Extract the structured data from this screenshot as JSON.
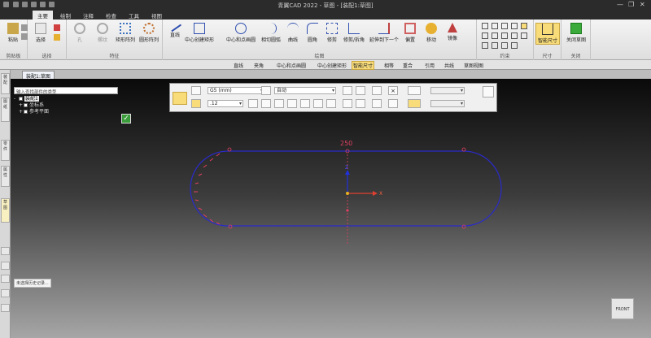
{
  "window": {
    "title": "青翼CAD 2022 - 草图 - [装配1:草图]",
    "controls": [
      "—",
      "❐",
      "✕"
    ]
  },
  "menu": {
    "tabs": [
      "主要",
      "绘制",
      "注释",
      "检查",
      "工具",
      "视图"
    ],
    "active": "主要"
  },
  "ribbon": {
    "clipboard": {
      "label": "剪贴板",
      "paste": "粘贴"
    },
    "select": {
      "label": "选择",
      "select": "选择"
    },
    "feature": {
      "label": "特征",
      "f1": "孔",
      "f2": "螺纹",
      "f3": "矩形阵列",
      "f4": "圆形阵列"
    },
    "draw": {
      "label": "绘图",
      "items": [
        "直线",
        "中心创建矩形",
        "中心和点画圆",
        "相切圆弧",
        "曲线",
        "圆角",
        "修剪",
        "修剪/拆角",
        "延伸到下一个",
        "偏置",
        "移动",
        "镜像"
      ]
    },
    "constraint": {
      "label": "约束"
    },
    "dimension": {
      "label": "尺寸",
      "smart": "智能尺寸"
    },
    "close": {
      "label": "关闭",
      "close_sketch": "关闭草图"
    }
  },
  "toolstrip": {
    "items": [
      "直线",
      "夹角",
      "中心和点画圆",
      "中心创建矩形",
      "智能尺寸",
      "相等",
      "重合",
      "引用",
      "共线",
      "草图视图"
    ],
    "highlight": "智能尺寸"
  },
  "left_strip": {
    "items": [
      "装配",
      "图纸",
      "零件",
      "属性",
      "草图"
    ]
  },
  "doc": {
    "tab": "装配1:草图"
  },
  "tree": {
    "filter_placeholder": "输入查找部件的类型",
    "rows": [
      {
        "label": "装配1"
      },
      {
        "label": "坐标系"
      },
      {
        "label": "参考平面"
      }
    ]
  },
  "dimbar": {
    "unit": "G5 (mm)",
    "mode": "自动",
    "precision": ".12"
  },
  "sketch": {
    "dimension_label": "250",
    "axis_z": "Z",
    "axis_x": "X"
  },
  "notes": {
    "text": "未选择历史记录..."
  },
  "viewcube": {
    "label": "FRONT"
  },
  "colors": {
    "sketch_line": "#2a2acc",
    "dimension": "#e04060",
    "highlight": "#f8dc7a",
    "axis_x": "#e04030",
    "axis_z": "#2030e0"
  }
}
